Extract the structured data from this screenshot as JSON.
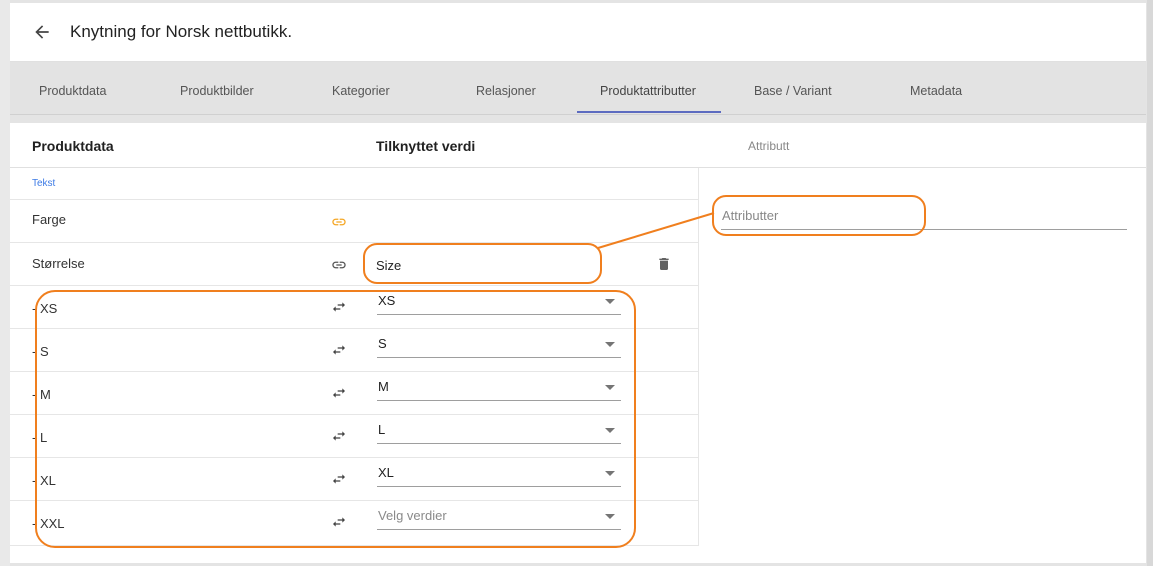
{
  "header": {
    "title": "Knytning for Norsk nettbutikk."
  },
  "tabs": [
    {
      "label": "Produktdata"
    },
    {
      "label": "Produktbilder"
    },
    {
      "label": "Kategorier"
    },
    {
      "label": "Relasjoner"
    },
    {
      "label": "Produktattributter",
      "active": true
    },
    {
      "label": "Base / Variant"
    },
    {
      "label": "Metadata"
    }
  ],
  "columns": {
    "product_data": "Produktdata",
    "linked_value": "Tilknyttet verdi",
    "attribute": "Attributt"
  },
  "section_label": "Tekst",
  "rows": {
    "farge": {
      "label": "Farge",
      "icon": "link-icon"
    },
    "storrelse": {
      "label": "Størrelse",
      "icon": "link-icon",
      "value": "Size"
    }
  },
  "size_rows": [
    {
      "label": "- XS",
      "value": "XS"
    },
    {
      "label": "- S",
      "value": "S"
    },
    {
      "label": "- M",
      "value": "M"
    },
    {
      "label": "- L",
      "value": "L"
    },
    {
      "label": "- XL",
      "value": "XL"
    },
    {
      "label": "- XXL",
      "placeholder": "Velg verdier"
    }
  ],
  "attribute_input": {
    "placeholder": "Attributter"
  },
  "colors": {
    "accent_link": "#f5a623",
    "tab_indicator": "#5c6bc0",
    "annotation": "#f07f1e",
    "section_label": "#3d7be5"
  }
}
